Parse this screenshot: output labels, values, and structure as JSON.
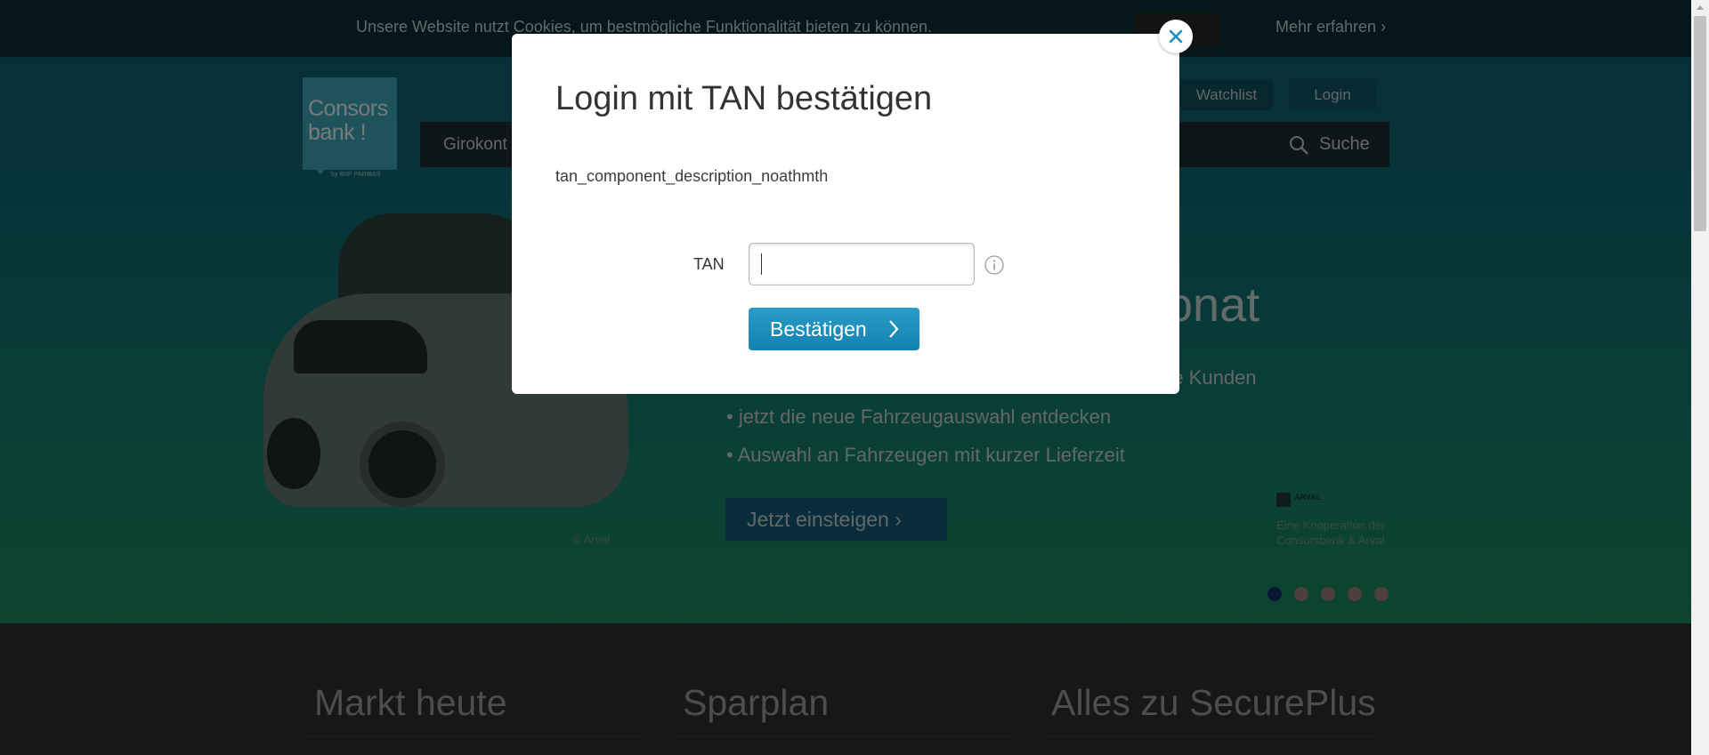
{
  "cookie_banner": {
    "text": "Unsere Website nutzt Cookies, um bestmögliche Funktionalität bieten zu können.",
    "more_label": "Mehr erfahren"
  },
  "header": {
    "logo_text": "Consors bank !",
    "logo_sub": "by BNP PARIBAS",
    "watchlist_label": "Watchlist",
    "login_label": "Login"
  },
  "nav": {
    "first_item": "Girokont",
    "search_label": "Suche",
    "search_icon": "search-icon"
  },
  "hero": {
    "heading": "onat",
    "bullets": [
      "re Kunden",
      "• jetzt die neue Fahrzeugauswahl entdecken",
      "• Auswahl an Fahrzeugen mit kurzer Lieferzeit"
    ],
    "cta_label": "Jetzt einsteigen",
    "copyright": "© Arval",
    "partner_logo": "ARVAL",
    "partner_note": "Eine Kooperation der Consorsbank & Arval",
    "carousel_dots": 5,
    "carousel_active": 1
  },
  "sections": [
    {
      "title": "Markt heute"
    },
    {
      "title": "Sparplan"
    },
    {
      "title": "Alles zu SecurePlus"
    }
  ],
  "modal": {
    "title": "Login mit TAN bestätigen",
    "description": "tan_component_description_noathmth",
    "tan_label": "TAN",
    "tan_value": "",
    "info_icon": "info-icon",
    "submit_label": "Bestätigen",
    "close_icon": "close-icon"
  },
  "colors": {
    "accent": "#1a8fbd",
    "close_icon": "#1a8fbd",
    "overlay": "rgba(0,0,0,0.5)"
  }
}
